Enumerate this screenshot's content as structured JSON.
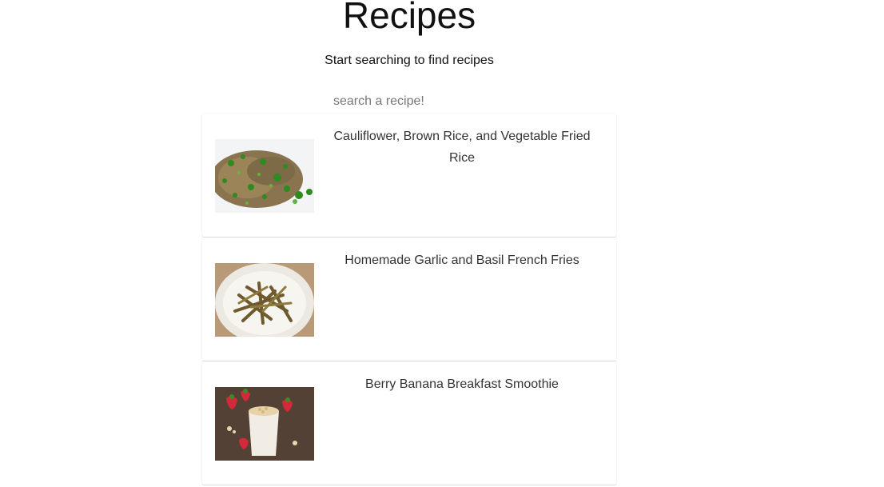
{
  "header": {
    "title": "Recipes",
    "subtitle": "Start searching to find recipes"
  },
  "search": {
    "placeholder": "search a recipe!",
    "value": ""
  },
  "recipes": [
    {
      "title": "Cauliflower, Brown Rice, and Vegetable Fried Rice",
      "image": "fried-rice-photo"
    },
    {
      "title": "Homemade Garlic and Basil French Fries",
      "image": "french-fries-photo"
    },
    {
      "title": "Berry Banana Breakfast Smoothie",
      "image": "smoothie-photo"
    }
  ]
}
